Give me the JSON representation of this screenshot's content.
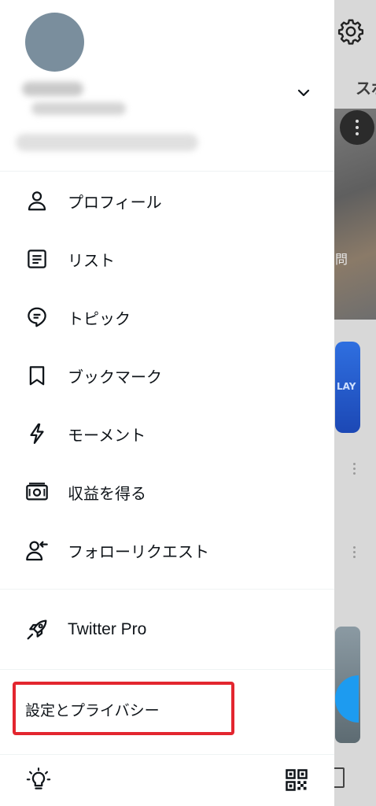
{
  "background": {
    "tab_partial": "スポ",
    "time_partial": "問"
  },
  "drawer": {
    "menu": [
      {
        "label": "プロフィール",
        "icon": "person-icon"
      },
      {
        "label": "リスト",
        "icon": "list-icon"
      },
      {
        "label": "トピック",
        "icon": "topic-icon"
      },
      {
        "label": "ブックマーク",
        "icon": "bookmark-icon"
      },
      {
        "label": "モーメント",
        "icon": "lightning-icon"
      },
      {
        "label": "収益を得る",
        "icon": "money-icon"
      },
      {
        "label": "フォローリクエスト",
        "icon": "follow-request-icon"
      }
    ],
    "pro": {
      "label": "Twitter Pro",
      "icon": "rocket-icon"
    },
    "settings": {
      "label": "設定とプライバシー"
    },
    "bottom": {
      "left_icon": "lightbulb-icon",
      "right_icon": "qr-code-icon"
    }
  },
  "colors": {
    "highlight": "#e3262f",
    "text": "#0f1419",
    "avatar": "#7a8e9d",
    "fab": "#1d9bf0"
  }
}
